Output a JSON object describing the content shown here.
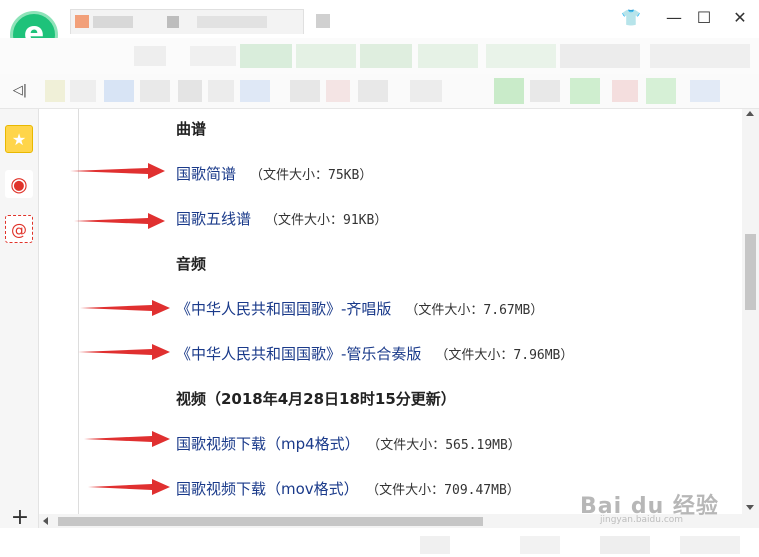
{
  "window": {
    "minimize_glyph": "—",
    "maximize_glyph": "☐",
    "close_glyph": "✕",
    "skin_glyph": "👕"
  },
  "logo_letter": "e",
  "sidebar": {
    "toggle_glyph": "◁|",
    "add_glyph": "+",
    "items": [
      {
        "icon": "star-icon",
        "glyph": "★",
        "color": "#f5b400"
      },
      {
        "icon": "weibo-icon",
        "glyph": "◉",
        "color": "#e0332a"
      },
      {
        "icon": "mail-icon",
        "glyph": "@",
        "color": "#e0332a"
      }
    ]
  },
  "content": {
    "sections": [
      {
        "heading": "曲谱",
        "items": [
          {
            "link": "国歌简谱",
            "size": "（文件大小：75KB）"
          },
          {
            "link": "国歌五线谱",
            "size": "（文件大小：91KB）"
          }
        ]
      },
      {
        "heading": "音频",
        "items": [
          {
            "link": "《中华人民共和国国歌》-齐唱版",
            "size": "（文件大小：7.67MB）"
          },
          {
            "link": "《中华人民共和国国歌》-管乐合奏版",
            "size": "（文件大小：7.96MB）"
          }
        ]
      },
      {
        "heading": "视频（2018年4月28日18时15分更新）",
        "items": [
          {
            "link": "国歌视频下载（mp4格式）",
            "size": "（文件大小：565.19MB）"
          },
          {
            "link": "国歌视频下载（mov格式）",
            "size": "（文件大小：709.47MB）"
          }
        ]
      }
    ]
  },
  "watermark": {
    "brand": "Bai du 经验",
    "url": "jingyan.baidu.com"
  },
  "colors": {
    "link": "#1a3a8a",
    "arrow": "#e03030",
    "logo": "#1ec27a"
  }
}
